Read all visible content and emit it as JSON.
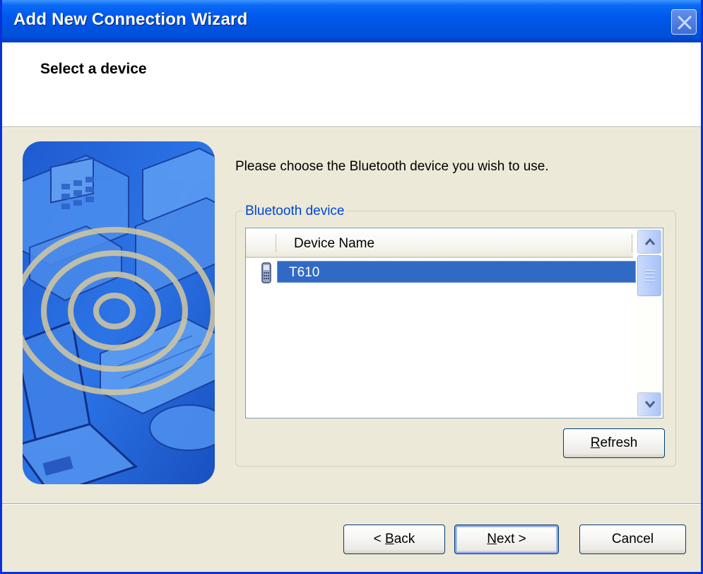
{
  "window": {
    "title": "Add New Connection Wizard"
  },
  "header": {
    "title": "Select a device"
  },
  "main": {
    "instruction": "Please choose the Bluetooth device you wish to use.",
    "group_label": "Bluetooth device",
    "list": {
      "columns": [
        "Device Name"
      ],
      "rows": [
        {
          "icon": "phone-icon",
          "name": "T610",
          "selected": true
        }
      ]
    },
    "refresh_button": {
      "mnemonic": "R",
      "rest": "efresh"
    }
  },
  "footer": {
    "back_button": {
      "prefix": "< ",
      "mnemonic": "B",
      "rest": "ack"
    },
    "next_button": {
      "mnemonic": "N",
      "rest": "ext >"
    },
    "cancel_button": "Cancel"
  },
  "colors": {
    "titlebar": "#0054E3",
    "selection": "#316AC5",
    "group_label": "#0046D5"
  }
}
